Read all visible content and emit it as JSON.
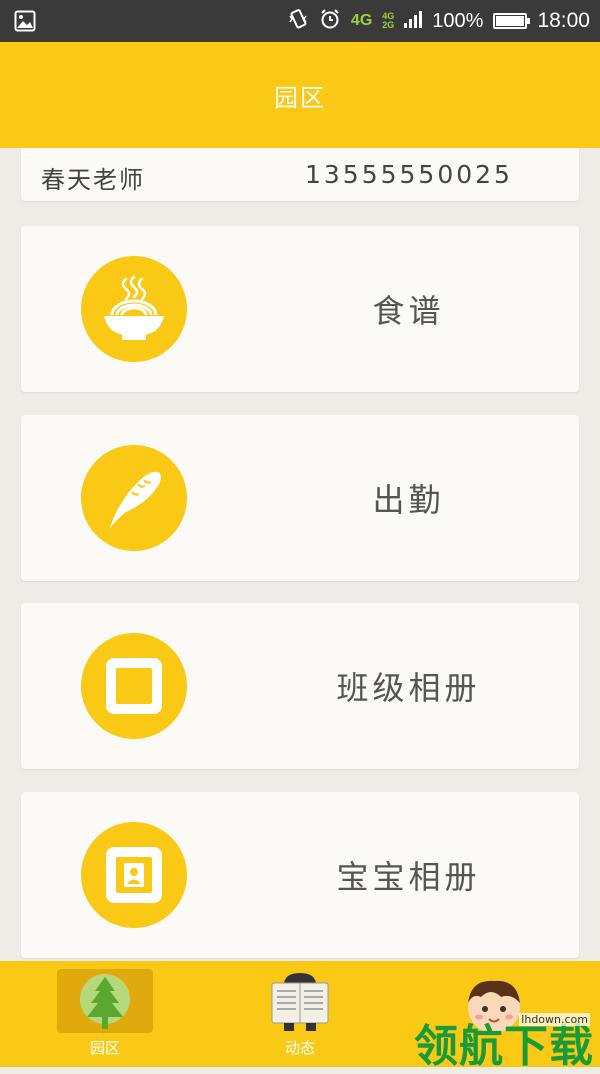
{
  "status_bar": {
    "network": "4G",
    "network_small_top": "4G",
    "network_small_bottom": "2G",
    "battery": "100%",
    "time": "18:00",
    "icons": [
      "gallery-icon",
      "vibrate-icon",
      "alarm-icon",
      "signal-icon",
      "battery-icon"
    ]
  },
  "header": {
    "title": "园区"
  },
  "teacher": {
    "name": "春天老师",
    "phone": "13555550025"
  },
  "menu": [
    {
      "label": "食谱",
      "icon": "noodle-bowl-icon"
    },
    {
      "label": "出勤",
      "icon": "feather-icon"
    },
    {
      "label": "班级相册",
      "icon": "photo-frame-icon"
    },
    {
      "label": "宝宝相册",
      "icon": "portrait-frame-icon"
    }
  ],
  "bottom_nav": [
    {
      "label": "园区",
      "icon": "tree-icon",
      "selected": true
    },
    {
      "label": "动态",
      "icon": "newspaper-reader-icon",
      "selected": false
    },
    {
      "label": "",
      "icon": "kid-face-icon",
      "selected": false
    }
  ],
  "watermark": {
    "text": "领航下载",
    "url": "lhdown.com"
  },
  "colors": {
    "primary": "#f9c916",
    "selected_tab": "#e0aa0f",
    "background": "#efece7",
    "card": "#fbfaf6"
  }
}
